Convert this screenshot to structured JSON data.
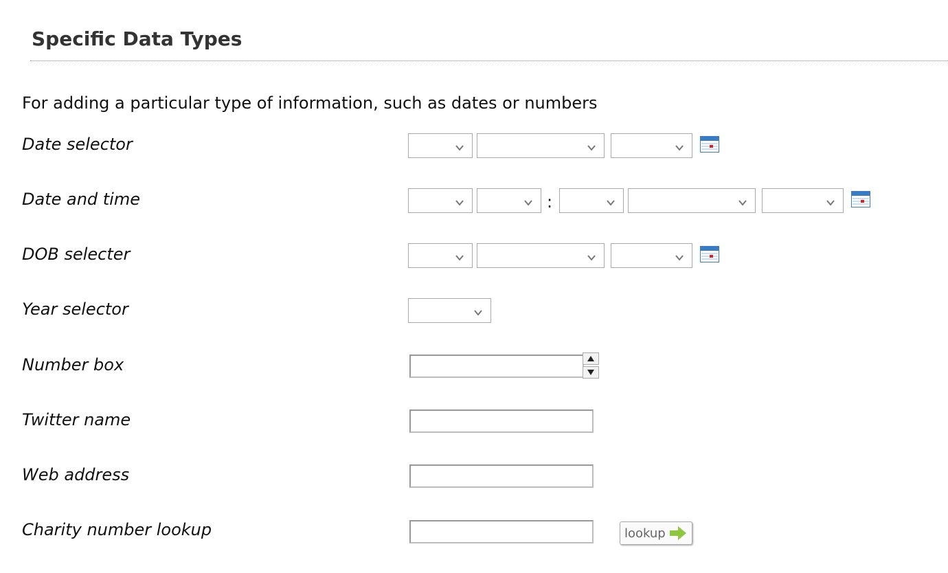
{
  "section": {
    "title": "Specific Data Types",
    "intro": "For adding a particular type of information, such as dates or numbers"
  },
  "fields": {
    "date_selector": "Date selector",
    "date_and_time": "Date and time",
    "dob_selecter": "DOB selecter",
    "year_selector": "Year selector",
    "number_box": "Number box",
    "twitter_name": "Twitter name",
    "web_address": "Web address",
    "charity_number_lookup": "Charity number lookup"
  },
  "time_separator": ":",
  "lookup_button": {
    "label": "lookup"
  },
  "icons": {
    "calendar": "calendar-icon",
    "chevron": "chevron-down-icon",
    "spin_up": "arrow-up-icon",
    "spin_down": "arrow-down-icon",
    "lookup_arrow": "arrow-right-icon"
  },
  "colors": {
    "heading": "#333333",
    "lookup_arrow": "#8dc63f",
    "calendar_blue": "#3a7bc8",
    "calendar_red": "#e02020"
  }
}
